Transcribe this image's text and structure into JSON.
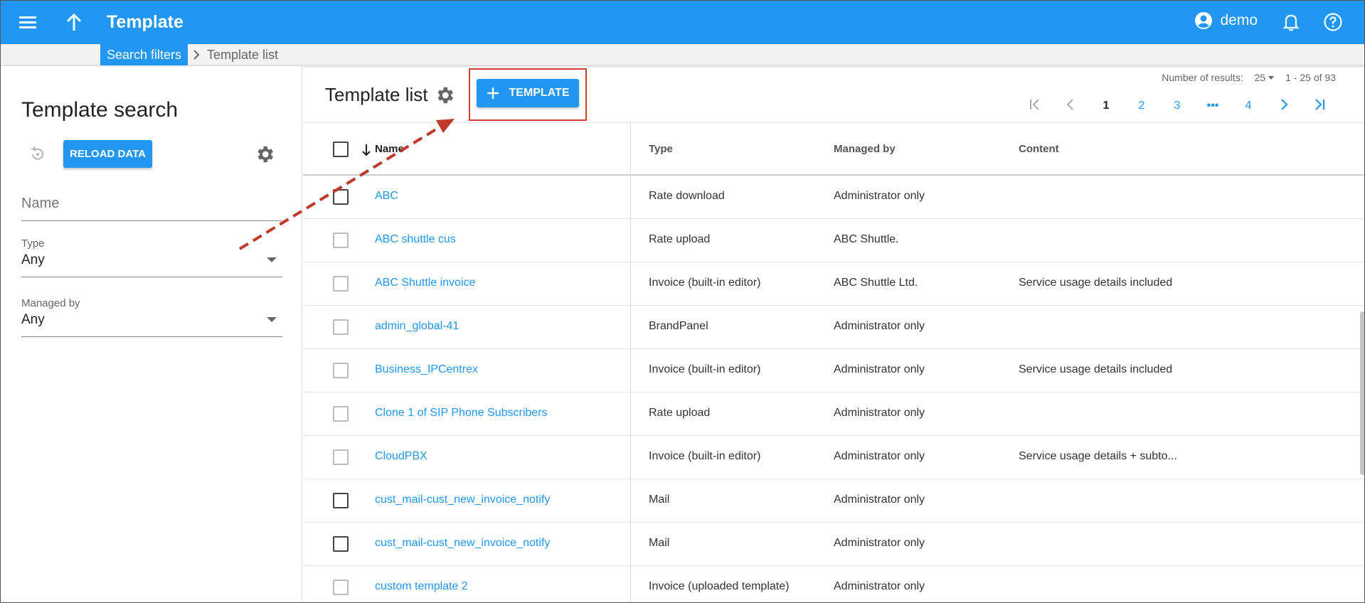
{
  "app": {
    "title": "Template",
    "user": "demo"
  },
  "breadcrumb": {
    "parent": "Search filters",
    "current": "Template list"
  },
  "search": {
    "title": "Template search",
    "reload_label": "RELOAD DATA",
    "name_placeholder": "Name",
    "type_label": "Type",
    "type_value": "Any",
    "managed_label": "Managed by",
    "managed_value": "Any"
  },
  "list": {
    "title": "Template list",
    "add_label": "TEMPLATE",
    "results_label": "Number of results:",
    "page_size": "25",
    "range": "1 - 25 of 93",
    "pages": [
      "1",
      "2",
      "3",
      "•••",
      "4"
    ],
    "columns": {
      "name": "Name",
      "type": "Type",
      "managed": "Managed by",
      "content": "Content"
    },
    "rows": [
      {
        "name": "ABC",
        "type": "Rate download",
        "managed": "Administrator only",
        "content": "",
        "dark": true
      },
      {
        "name": "ABC shuttle cus",
        "type": "Rate upload",
        "managed": "ABC Shuttle.",
        "content": "",
        "dark": false
      },
      {
        "name": "ABC Shuttle invoice",
        "type": "Invoice (built-in editor)",
        "managed": "ABC Shuttle Ltd.",
        "content": "Service usage details included",
        "dark": false
      },
      {
        "name": "admin_global-41",
        "type": "BrandPanel",
        "managed": "Administrator only",
        "content": "",
        "dark": false
      },
      {
        "name": "Business_IPCentrex",
        "type": "Invoice (built-in editor)",
        "managed": "Administrator only",
        "content": "Service usage details included",
        "dark": false
      },
      {
        "name": "Clone 1 of SIP Phone Subscribers",
        "type": "Rate upload",
        "managed": "Administrator only",
        "content": "",
        "dark": false
      },
      {
        "name": "CloudPBX",
        "type": "Invoice (built-in editor)",
        "managed": "Administrator only",
        "content": "Service usage details + subto...",
        "dark": false
      },
      {
        "name": "cust_mail-cust_new_invoice_notify",
        "type": "Mail",
        "managed": "Administrator only",
        "content": "",
        "dark": true
      },
      {
        "name": "cust_mail-cust_new_invoice_notify",
        "type": "Mail",
        "managed": "Administrator only",
        "content": "",
        "dark": true
      },
      {
        "name": "custom template 2",
        "type": "Invoice (uploaded template)",
        "managed": "Administrator only",
        "content": "",
        "dark": false
      }
    ]
  },
  "colors": {
    "accent": "#2196f3",
    "highlight": "#d23f31",
    "arrow": "#c0392b"
  },
  "icons": [
    "menu-icon",
    "arrow-up-icon",
    "account-icon",
    "bell-icon",
    "help-icon",
    "chevron-right-icon",
    "reset-icon",
    "gear-icon",
    "plus-icon",
    "first-page-icon",
    "prev-page-icon",
    "next-page-icon",
    "last-page-icon",
    "sort-down-icon"
  ]
}
